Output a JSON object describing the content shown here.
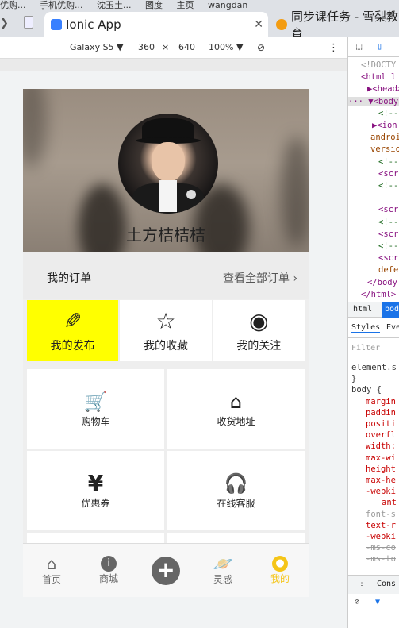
{
  "browser": {
    "top_strip": [
      "优购...",
      "手机优购...",
      "沈玉土...",
      "图度",
      "主页",
      "wangdan"
    ],
    "tabs": [
      {
        "title": "Ionic App",
        "active": true
      },
      {
        "title": "同步课任务 - 雪梨教育",
        "active": false
      }
    ]
  },
  "device_toolbar": {
    "device": "Galaxy S5 ▼",
    "width": "360",
    "times": "×",
    "height": "640",
    "zoom": "100% ▼"
  },
  "profile": {
    "username": "土方桔桔桔"
  },
  "orders": {
    "title": "我的订单",
    "view_all": "查看全部订单"
  },
  "quick_actions": [
    {
      "label": "我的发布",
      "icon": "pencil-icon",
      "glyph": "✏"
    },
    {
      "label": "我的收藏",
      "icon": "star-icon",
      "glyph": "☆"
    },
    {
      "label": "我的关注",
      "icon": "eye-icon",
      "glyph": "👁"
    }
  ],
  "services": [
    {
      "label": "购物车",
      "icon": "cart-icon",
      "glyph": "🛒"
    },
    {
      "label": "收货地址",
      "icon": "home-icon",
      "glyph": "⌂"
    },
    {
      "label": "优惠券",
      "icon": "yen-icon",
      "glyph": "¥"
    },
    {
      "label": "在线客服",
      "icon": "headphones-icon",
      "glyph": "🎧"
    }
  ],
  "bottom_tabs": [
    {
      "label": "首页",
      "icon": "home-icon",
      "glyph": "⌂",
      "active": false
    },
    {
      "label": "商城",
      "icon": "info-icon",
      "glyph": "ℹ",
      "active": false
    },
    {
      "label": "",
      "icon": "add-circle-icon",
      "glyph": "+",
      "active": false
    },
    {
      "label": "灵感",
      "icon": "planet-icon",
      "glyph": "🪐",
      "active": false
    },
    {
      "label": "我的",
      "icon": "person-icon",
      "glyph": "👤",
      "active": true
    }
  ],
  "devtools": {
    "elements": [
      "<!DOCTY",
      "<html l",
      "▶<head>",
      "··· ▼<body",
      "<!--",
      "▶<ion",
      "androi",
      "versio",
      "<!--",
      "<scr",
      "<!--",
      "",
      "<scr",
      "<!--",
      "<scr",
      "<!--",
      "<scr",
      "defe",
      "</body",
      "</html>"
    ],
    "tabs": [
      "html",
      "bod"
    ],
    "style_tabs": [
      "Styles",
      "Eve"
    ],
    "filter": "Filter",
    "style_lines": [
      "element.s",
      "}",
      "body {",
      "margin",
      "paddin",
      "positi",
      "overfl",
      "width:",
      "max-wi",
      "height",
      "max-he",
      "-webki",
      "ant",
      "font-s",
      "text-r",
      "-webki",
      "-ms-co",
      "-ms-to"
    ],
    "console": "Cons"
  },
  "colors": {
    "active_cell": "#ffff00",
    "active_tab": "#f5c518"
  }
}
